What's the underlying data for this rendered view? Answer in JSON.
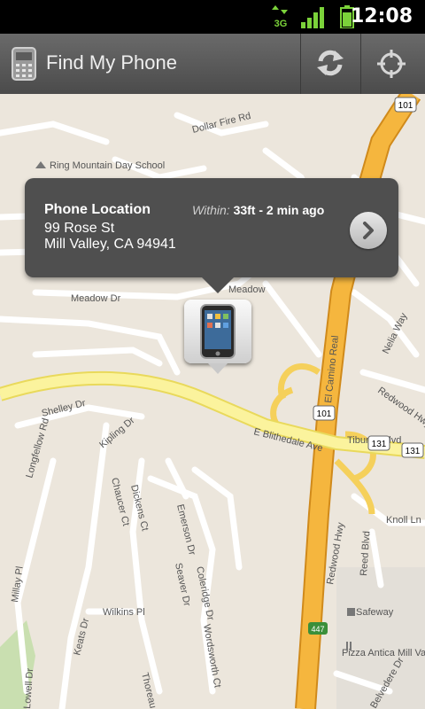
{
  "status_bar": {
    "network": "3G",
    "time": "12:08",
    "icons": [
      "network-3g-icon",
      "signal-icon",
      "battery-icon"
    ]
  },
  "title_bar": {
    "title": "Find My Phone",
    "icons": [
      "phone-app-icon",
      "refresh-icon",
      "locate-icon"
    ]
  },
  "popup": {
    "heading": "Phone Location",
    "address_line1": "99 Rose St",
    "address_line2": "Mill Valley, CA 94941",
    "within_label": "Within:",
    "within_value": "33ft - 2 min ago"
  },
  "map": {
    "labels": {
      "tiburon_blvd": "Tiburon Blvd",
      "e_blithedale": "E Blithedale Ave",
      "el_camino": "El Camino Real",
      "redwood_hwy_right": "Redwood Hwy",
      "redwood_hwy_bottom": "Redwood Hwy",
      "meadow_dr": "Meadow Dr",
      "meadow_dr2": "Meadow",
      "shelley_dr": "Shelley Dr",
      "kipling_dr": "Kipling Dr",
      "longfellow_rd": "Longfellow Rd",
      "dickens_ct": "Dickens Ct",
      "chaucer_ct": "Chaucer Ct",
      "emerson_dr": "Emerson Dr",
      "coleridge_dr": "Coleridge Dr",
      "seaver_dr": "Seaver Dr",
      "wordsworth_ct": "Wordsworth Ct",
      "wilkins_pl": "Wilkins Pl",
      "keats_dr": "Keats Dr",
      "thoreau_dr": "Thoreau Dr",
      "millay_pl": "Millay Pl",
      "lowell_dr": "Lowell Dr",
      "dollar_fire_rd": "Dollar Fire Rd",
      "school": "Ring Mountain Day School",
      "nelia_way": "Nelia Way",
      "knoll_ln": "Knoll Ln",
      "reed_blvd": "Reed Blvd",
      "safeway": "Safeway",
      "pizza": "Pizza Antica Mill Valley",
      "belvedere_dr": "Belvedere Dr",
      "shield_101_a": "101",
      "shield_101_b": "101",
      "shield_131_a": "131",
      "shield_131_b": "131",
      "shield_447": "447"
    }
  }
}
